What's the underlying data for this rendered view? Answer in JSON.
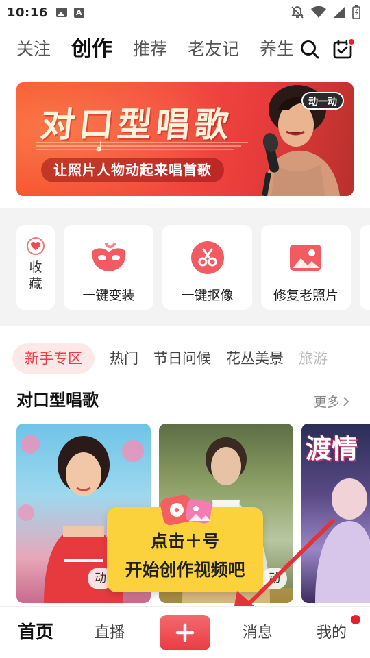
{
  "status_bar": {
    "time": "10:16"
  },
  "top_tabs": {
    "items": [
      {
        "label": "关注"
      },
      {
        "label": "创作",
        "active": true
      },
      {
        "label": "推荐"
      },
      {
        "label": "老友记"
      },
      {
        "label": "养生"
      }
    ]
  },
  "banner": {
    "title": "对口型唱歌",
    "subtitle": "让照片人物动起来唱首歌",
    "badge": "动一动"
  },
  "tools": {
    "favorite_label": "收藏",
    "items": [
      {
        "label": "一键变装",
        "icon": "mask-icon"
      },
      {
        "label": "一键抠像",
        "icon": "scissors-icon"
      },
      {
        "label": "修复老照片",
        "icon": "photo-icon"
      }
    ]
  },
  "chips": {
    "items": [
      {
        "label": "新手专区",
        "active": true
      },
      {
        "label": "热门"
      },
      {
        "label": "节日问候"
      },
      {
        "label": "花丛美景"
      },
      {
        "label": "旅游"
      }
    ]
  },
  "section": {
    "title": "对口型唱歌",
    "more": "更多"
  },
  "cards": {
    "items": [
      {
        "tag": "动"
      },
      {
        "tag": "动"
      },
      {
        "title": "渡情"
      }
    ]
  },
  "tooltip": {
    "line1": "点击＋号",
    "line2": "开始创作视频吧"
  },
  "bottom_nav": {
    "home": "首页",
    "live": "直播",
    "messages": "消息",
    "mine": "我的"
  },
  "colors": {
    "accent": "#ee3b40",
    "tooltip": "#fcd23c",
    "banner": "#f34a3d"
  }
}
